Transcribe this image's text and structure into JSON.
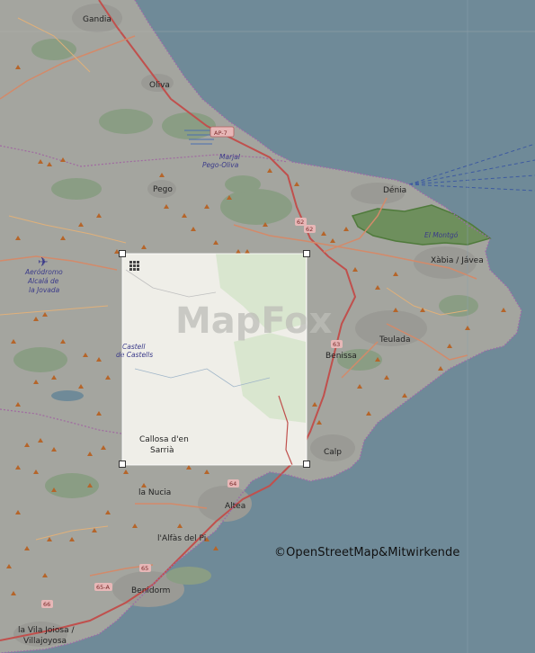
{
  "map": {
    "places": {
      "gandia": "Gandia",
      "oliva": "Oliva",
      "pego": "Pego",
      "denia": "Dénia",
      "xabia": "Xàbia / Jávea",
      "teulada": "Teulada",
      "benissa": "Benissa",
      "calp": "Calp",
      "altea": "Altea",
      "la_nucia": "la Nucia",
      "lalfas": "l'Alfàs del Pi",
      "benidorm": "Benidorm",
      "villajoyosa_1": "la Vila Joiosa /",
      "villajoyosa_2": "Villajoyosa",
      "callosa_1": "Callosa d'en",
      "callosa_2": "Sarrià"
    },
    "features": {
      "marjal_1": "Marjal",
      "marjal_2": "Pego-Oliva",
      "montgo": "El Montgó",
      "aerodromo_1": "Aeródromo",
      "aerodromo_2": "Alcalá de",
      "aerodromo_3": "la Jovada",
      "castell_1": "Castell",
      "castell_2": "de Castells"
    },
    "roads": {
      "ap7": "AP-7",
      "r62": "62",
      "r63": "63",
      "r64": "64",
      "r65": "65",
      "r65a": "65-A",
      "r66": "66",
      "r62b": "62"
    },
    "watermark": "MapFox",
    "copyright": "©OpenStreetMap&Mitwirkende"
  }
}
